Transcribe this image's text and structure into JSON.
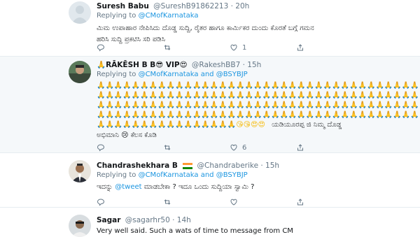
{
  "tweets": [
    {
      "name": "Suresh Babu",
      "handle": "@SureshB91862213 · 20h",
      "replying_prefix": "Replying to",
      "replying_to": "@CMofKarnataka",
      "lines": [
        "ಮಿಮ ಉಪಾಹಾರ ನೇಪಿಸಿದು ದೊಡ್ಡ ಸುದ್ದಿ, ರೈತರ ಹಾಗೂ ಕಾರ್ಮಿಕರ ದುಂದು ಕೊರತೆ ಬಗ್ಗೆ ಗಮನ",
        "ಹರಿಸಿ ಸುದ್ದಿ ಪ್ರಕಟಿಸಿ ಸರಿ ಪಡಿಸಿ"
      ],
      "actions": {
        "reply": "",
        "retweet": "",
        "like": "1"
      }
    },
    {
      "name": "🙏RĀKĒSH B B😎 VIP😍",
      "handle": "@RakeshBB7 · 15h",
      "replying_prefix": "Replying to",
      "replying_to": "@CMofKarnataka and @BSYBJP",
      "pray_rows": [
        "🙏🙏🙏🙏🙏🙏🙏🙏🙏🙏🙏🙏🙏🙏🙏🙏🙏🙏🙏🙏🙏🙏🙏🙏🙏🙏🙏🙏🙏🙏🙏🙏🙏🙏🙏🙏🙏",
        "🙏🙏🙏🙏🙏🙏🙏🙏🙏🙏🙏🙏🙏🙏🙏🙏🙏🙏🙏🙏🙏🙏🙏🙏🙏🙏🙏🙏🙏🙏🙏🙏🙏🙏🙏🙏🙏",
        "🙏🙏🙏🙏🙏🙏🙏🙏🙏🙏🙏🙏🙏🙏🙏🙏🙏🙏🙏🙏🙏🙏🙏🙏🙏🙏🙏🙏🙏🙏🙏🙏🙏🙏🙏🙏🙏",
        "🙏🙏🙏🙏🙏🙏🙏🙏🙏🙏🙏🙏🙏🙏🙏🙏🙏🙏🙏🙏🙏🙏🙏🙏🙏🙏🙏🙏🙏🙏🙏🙏🙏🙏🙏🙏🙏"
      ],
      "last_row_prefix": "🙏🙏🙏🙏🙏🙏🙏🙏🙏🙏🙏🙏🙏🙏🙏🙏😘😘😍😍",
      "last_row_text": "ಯಡಿಯೂರಪ್ಪ ಜಿ ನಿಮ್ಮ ದೊಡ್ಡ",
      "last_line": "ಅಭಿಮಾನಿ 😢 ಕೆಲಸ ಕೊಡಿ",
      "actions": {
        "reply": "",
        "retweet": "",
        "like": "6"
      }
    },
    {
      "name": "Chandrashekhara B",
      "handle": "@Chandraberike · 15h",
      "replying_prefix": "Replying to",
      "replying_to": "@CMofKarnataka and @BSYBJP",
      "text_before": "ಇದನ್ನು ",
      "text_link": "@tweet",
      "text_after": " ಮಾಡಬೇಕಾ ? ಇದೂ ಒಂದು ಸುದ್ದಿಯಾ ಸ್ವಾಮಿ ?",
      "actions": {
        "reply": "",
        "retweet": "",
        "like": ""
      }
    },
    {
      "name": "Sagar",
      "handle": "@sagarhr50 · 14h",
      "text": "Very well said. Such a wats of time to message from CM"
    }
  ],
  "colors": {
    "link": "#1b95e0",
    "muted": "#657786",
    "highlight": "#f5f8fa"
  }
}
